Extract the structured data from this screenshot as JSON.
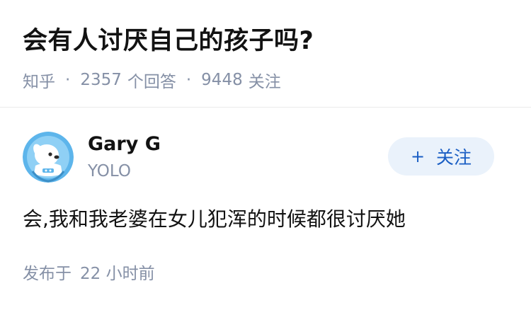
{
  "question": {
    "title": "会有人讨厌自己的孩子吗?",
    "source": "知乎",
    "separator": "·",
    "answer_count": "2357",
    "answer_label": "个回答",
    "follower_count": "9448",
    "follower_label": "关注"
  },
  "author": {
    "avatar_icon": "puppy-avatar-icon",
    "name": "Gary G",
    "bio": "YOLO",
    "follow_icon": "+",
    "follow_label": "关注"
  },
  "answer": {
    "content": "会,我和我老婆在女儿犯浑的时候都很讨厌她",
    "posted_label": "发布于",
    "posted_time": "22 小时前"
  },
  "colors": {
    "meta_gray": "#8590a6",
    "follow_bg": "#eaf2fb",
    "follow_text": "#1a5ec4",
    "avatar_blue": "#5db5eb"
  }
}
